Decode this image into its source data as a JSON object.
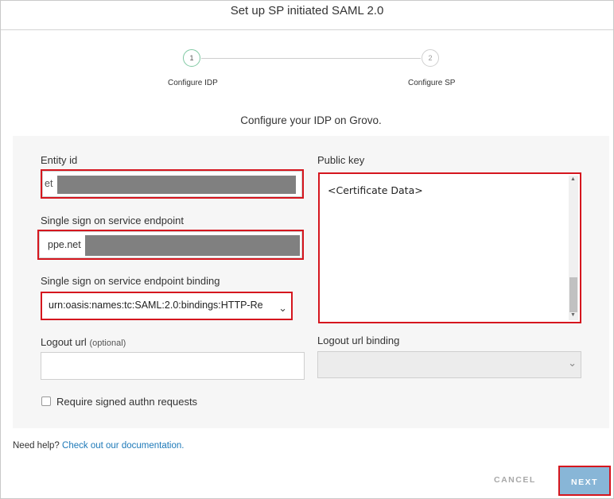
{
  "title": "Set up SP initiated SAML 2.0",
  "stepper": {
    "steps": [
      {
        "number": "1",
        "label": "Configure IDP"
      },
      {
        "number": "2",
        "label": "Configure SP"
      }
    ]
  },
  "subheading": "Configure your IDP on Grovo.",
  "form": {
    "entity_id": {
      "label": "Entity id",
      "value": "et"
    },
    "sso_endpoint": {
      "label": "Single sign on service endpoint",
      "value": "ppe.net"
    },
    "sso_binding": {
      "label": "Single sign on service endpoint binding",
      "value": "urn:oasis:names:tc:SAML:2.0:bindings:HTTP-Re"
    },
    "logout_url": {
      "label": "Logout url",
      "optional": "(optional)",
      "value": ""
    },
    "public_key": {
      "label": "Public key",
      "value": "<Certificate Data>"
    },
    "logout_binding": {
      "label": "Logout url binding",
      "value": ""
    },
    "require_signed": {
      "label": "Require signed authn requests",
      "checked": false
    }
  },
  "help": {
    "prefix": "Need help?",
    "link": "Check out our documentation."
  },
  "buttons": {
    "cancel": "CANCEL",
    "next": "NEXT"
  },
  "colors": {
    "highlight": "#d5161e",
    "link": "#1d79b8",
    "next_button": "#88b6d7",
    "step_active": "#7fc8a2"
  }
}
